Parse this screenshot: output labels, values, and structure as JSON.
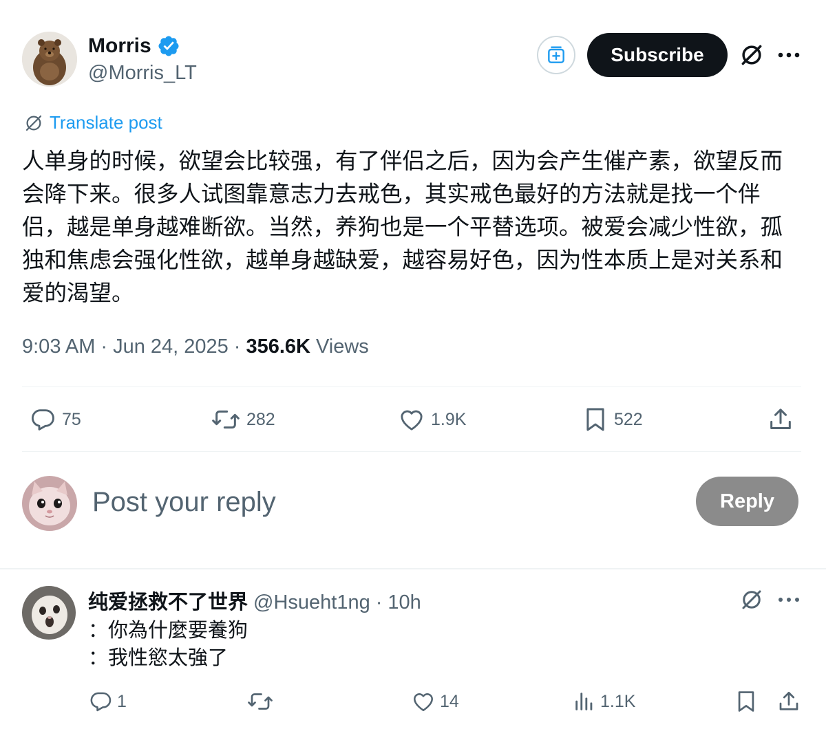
{
  "post": {
    "author": {
      "name": "Morris",
      "handle": "@Morris_LT",
      "verified": true
    },
    "actions": {
      "subscribe_label": "Subscribe"
    },
    "translate_label": "Translate post",
    "body": "人单身的时候，欲望会比较强，有了伴侣之后，因为会产生催产素，欲望反而会降下来。很多人试图靠意志力去戒色，其实戒色最好的方法就是找一个伴侣，越是单身越难断欲。当然，养狗也是一个平替选项。被爱会减少性欲，孤独和焦虑会强化性欲，越单身越缺爱，越容易好色，因为性本质上是对关系和爱的渴望。",
    "meta": {
      "time": "9:03 AM",
      "sep1": "·",
      "date": "Jun 24, 2025",
      "sep2": "·",
      "views_count": "356.6K",
      "views_label": "Views"
    },
    "stats": {
      "replies": "75",
      "reposts": "282",
      "likes": "1.9K",
      "bookmarks": "522"
    }
  },
  "composer": {
    "placeholder": "Post your reply",
    "reply_label": "Reply"
  },
  "reply": {
    "name": "纯爱拯救不了世界",
    "handle": "@Hsueht1ng",
    "sep": "·",
    "time": "10h",
    "lines": [
      "：你為什麼要養狗",
      "：我性慾太強了"
    ],
    "stats": {
      "replies": "1",
      "reposts": "",
      "likes": "14",
      "views": "1.1K"
    }
  },
  "colors": {
    "verified": "#1d9bf0",
    "subscribe_bg": "#0f1419",
    "reply_btn_bg": "#8b8b8b",
    "translate": "#1d9bf0",
    "muted": "#536471"
  },
  "icons": [
    "verified-badge-icon",
    "subscriptions-icon",
    "grok-icon",
    "more-icon",
    "translate-icon",
    "reply-icon",
    "repost-icon",
    "like-icon",
    "bookmark-icon",
    "share-icon",
    "views-icon"
  ]
}
